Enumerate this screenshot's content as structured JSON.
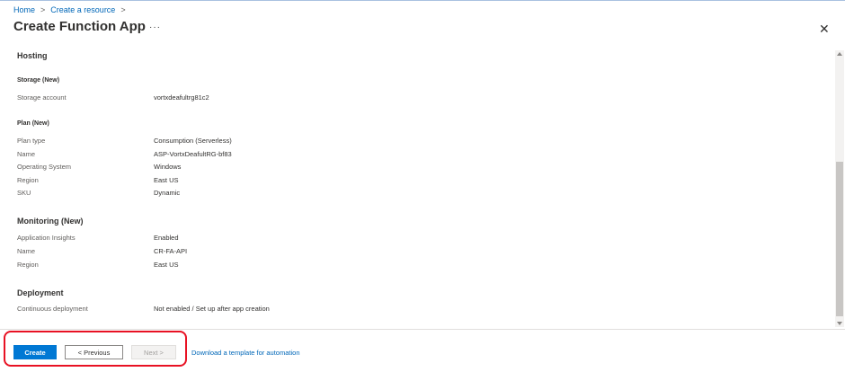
{
  "breadcrumb": {
    "home": "Home",
    "separator": ">",
    "create_resource": "Create a resource"
  },
  "header": {
    "title": "Create Function App",
    "more_label": "···",
    "close_label": "✕"
  },
  "hosting": {
    "section_title": "Hosting",
    "storage_subhead": "Storage (New)",
    "storage_rows": [
      {
        "key": "Storage account",
        "value": "vortxdeafultrg81c2"
      }
    ],
    "plan_subhead": "Plan (New)",
    "plan_rows": [
      {
        "key": "Plan type",
        "value": "Consumption (Serverless)"
      },
      {
        "key": "Name",
        "value": "ASP-VortxDeafultRG-bf83"
      },
      {
        "key": "Operating System",
        "value": "Windows"
      },
      {
        "key": "Region",
        "value": "East US"
      },
      {
        "key": "SKU",
        "value": "Dynamic"
      }
    ]
  },
  "monitoring": {
    "section_title": "Monitoring (New)",
    "rows": [
      {
        "key": "Application Insights",
        "value": "Enabled"
      },
      {
        "key": "Name",
        "value": "CR-FA-API"
      },
      {
        "key": "Region",
        "value": "East US"
      }
    ]
  },
  "deployment": {
    "section_title": "Deployment",
    "rows": [
      {
        "key": "Continuous deployment",
        "value": "Not enabled / Set up after app creation"
      }
    ]
  },
  "footer": {
    "create_label": "Create",
    "previous_label": "< Previous",
    "next_label": "Next >",
    "template_link": "Download a template for automation"
  },
  "colors": {
    "primary": "#0078d4",
    "link": "#0067b8",
    "annotation": "#e81123"
  }
}
